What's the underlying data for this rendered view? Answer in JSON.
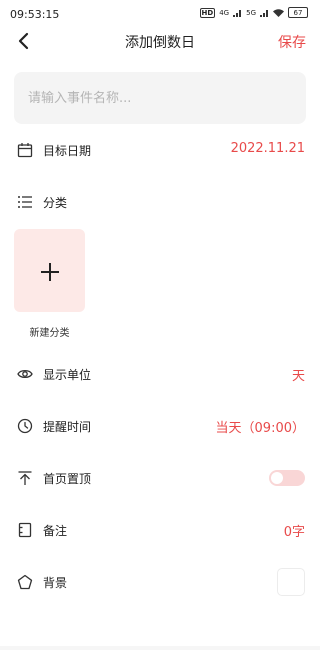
{
  "status_bar": {
    "time": "09:53:15",
    "hd_badge": "HD",
    "network_1": "4G",
    "network_2": "5G",
    "battery": "67"
  },
  "nav": {
    "title": "添加倒数日",
    "save_label": "保存"
  },
  "event_name": {
    "value": "",
    "placeholder": "请输入事件名称..."
  },
  "target_date": {
    "label": "目标日期",
    "value": "2022.11.21"
  },
  "category": {
    "label": "分类",
    "new_label": "新建分类"
  },
  "display_unit": {
    "label": "显示单位",
    "value": "天"
  },
  "reminder": {
    "label": "提醒时间",
    "value": "当天（09:00）"
  },
  "pin_home": {
    "label": "首页置顶",
    "enabled": false
  },
  "note": {
    "label": "备注",
    "value": "0字"
  },
  "background": {
    "label": "背景"
  },
  "colors": {
    "accent": "#e84a4a",
    "tile_bg": "#fde9e7",
    "toggle_off": "#f9d6d6"
  },
  "icons": {
    "back": "chevron-left-icon",
    "date": "calendar-icon",
    "category": "list-icon",
    "add": "plus-icon",
    "unit": "eye-icon",
    "reminder": "clock-icon",
    "pin": "pin-top-icon",
    "note": "note-icon",
    "background": "pentagon-icon"
  }
}
